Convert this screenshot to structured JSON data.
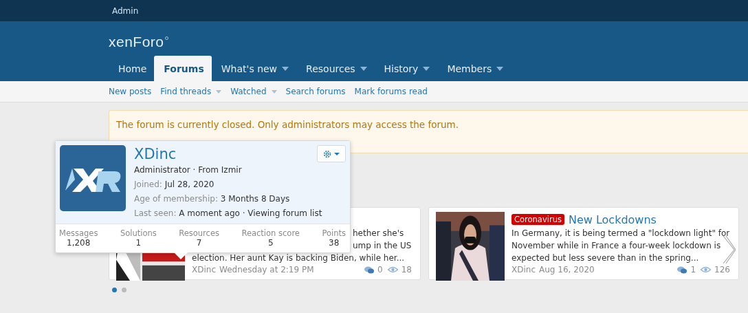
{
  "top_bar": {
    "admin_link": "Admin"
  },
  "logo": {
    "text": "xenForo"
  },
  "nav_tabs": [
    {
      "label": "Home",
      "selected": false,
      "has_menu": false
    },
    {
      "label": "Forums",
      "selected": true,
      "has_menu": false
    },
    {
      "label": "What's new",
      "selected": false,
      "has_menu": true
    },
    {
      "label": "Resources",
      "selected": false,
      "has_menu": true
    },
    {
      "label": "History",
      "selected": false,
      "has_menu": true
    },
    {
      "label": "Members",
      "selected": false,
      "has_menu": true
    }
  ],
  "sub_nav": [
    {
      "label": "New posts",
      "has_menu": false
    },
    {
      "label": "Find threads",
      "has_menu": true
    },
    {
      "label": "Watched",
      "has_menu": true
    },
    {
      "label": "Search forums",
      "has_menu": false
    },
    {
      "label": "Mark forums read",
      "has_menu": false
    }
  ],
  "notice": {
    "message": "The forum is currently closed. Only administrators may access the forum."
  },
  "cards": [
    {
      "excerpt_lines": [
        {
          "text": "hether she's",
          "indent": true
        },
        {
          "text": "ump in the US",
          "indent": true
        },
        {
          "text": "election. Her aunt Kay is backing Biden, while her...",
          "indent": false
        }
      ],
      "author": "XDinc",
      "date": "Wednesday at 2:19 PM",
      "replies": "0",
      "views": "18"
    },
    {
      "tag": "Coronavirus",
      "title": "New Lockdowns",
      "excerpt_lines": [
        {
          "text": "In Germany, it is being termed a \"lockdown light\" for",
          "indent": false
        },
        {
          "text": "November while in France a four-week lockdown is",
          "indent": false
        },
        {
          "text": "expected but less severe than in the spring...",
          "indent": false
        }
      ],
      "author": "XDinc",
      "date": "Aug 16, 2020",
      "replies": "1",
      "views": "126",
      "has_next": true
    }
  ],
  "carousel_dots": [
    {
      "selected": true
    },
    {
      "selected": false
    }
  ],
  "member_tooltip": {
    "name": "XDinc",
    "role": "Administrator · From Izmir",
    "facts": [
      {
        "label": "Joined:",
        "value": "Jul 28, 2020"
      },
      {
        "label": "Age of membership:",
        "value": "3 Months 8 Days"
      },
      {
        "label": "Last seen:",
        "value": "A moment ago · Viewing forum list"
      }
    ],
    "stats": [
      {
        "label": "Messages",
        "value": "1,208"
      },
      {
        "label": "Solutions",
        "value": "1"
      },
      {
        "label": "Resources",
        "value": "7"
      },
      {
        "label": "Reaction score",
        "value": "5"
      },
      {
        "label": "Points",
        "value": "38"
      }
    ]
  }
}
